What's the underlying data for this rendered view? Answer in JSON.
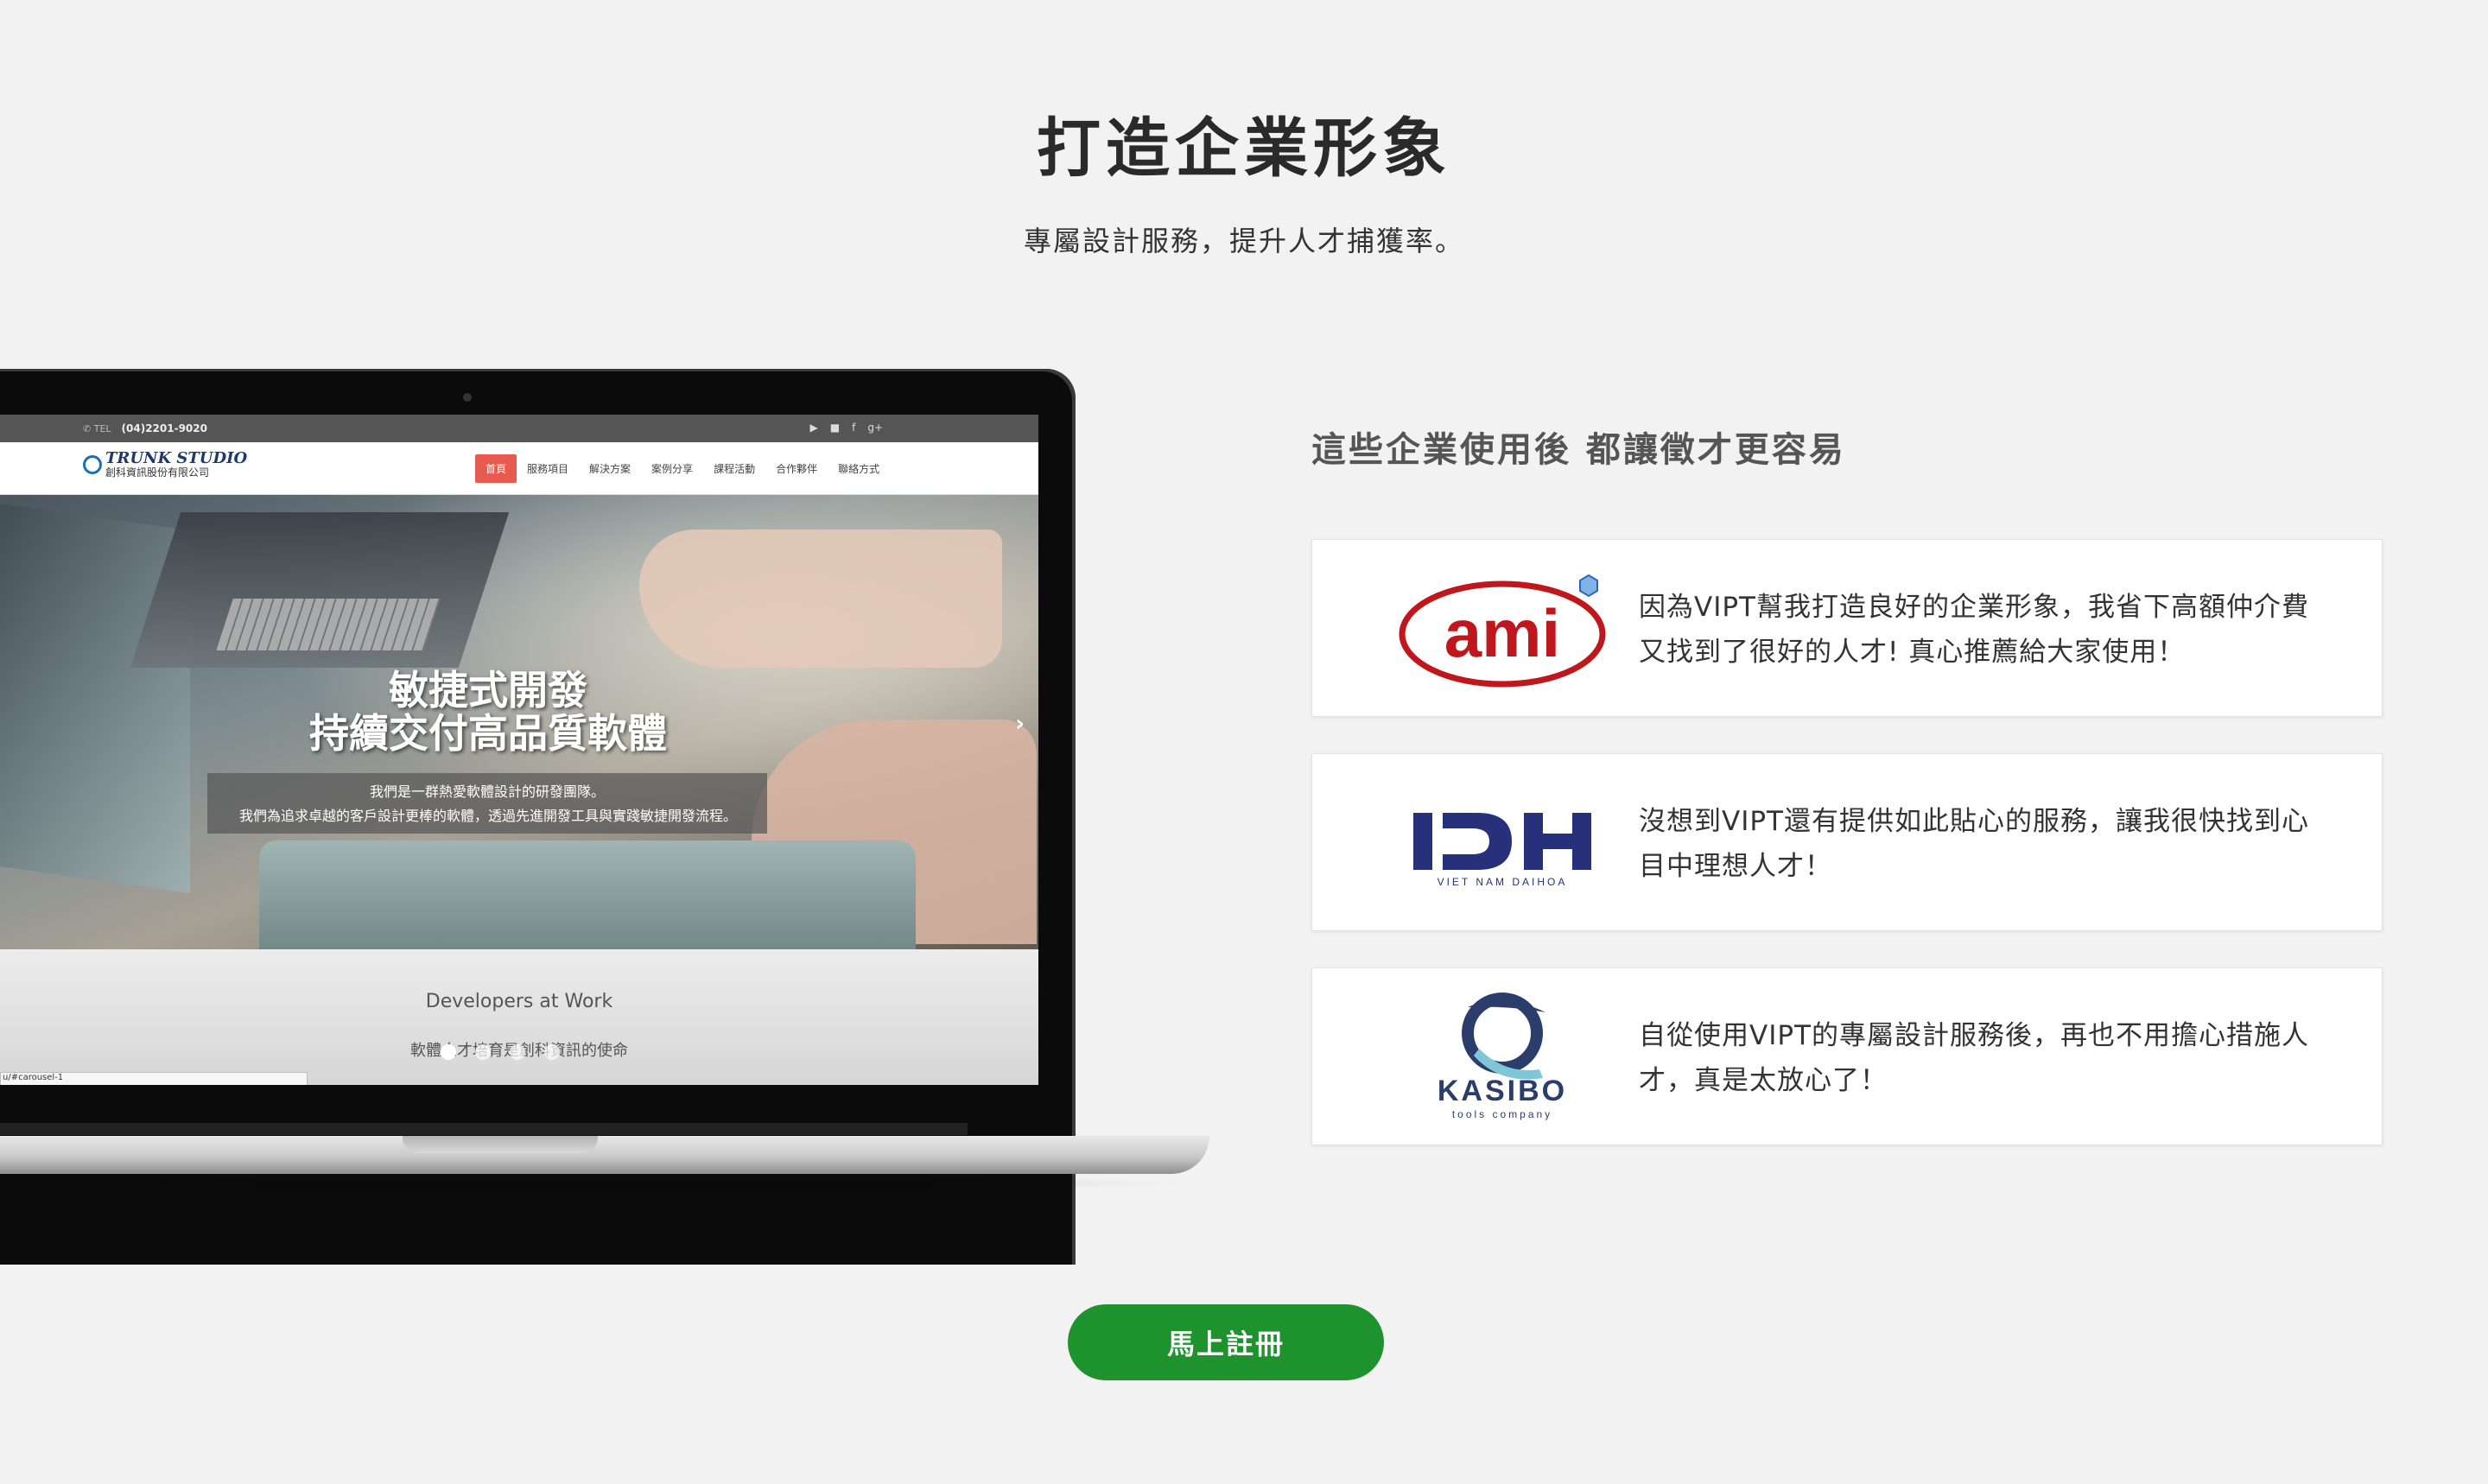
{
  "section": {
    "title": "打造企業形象",
    "subtitle": "專屬設計服務，提升人才捕獲率。"
  },
  "mockup_site": {
    "tel_label": "TEL",
    "tel": "(04)2201-9020",
    "logo_name": "TRUNK STUDIO",
    "logo_sub": "創科資訊股份有限公司",
    "menu": [
      "首頁",
      "服務項目",
      "解決方案",
      "案例分享",
      "課程活動",
      "合作夥伴",
      "聯絡方式"
    ],
    "hero_title_1": "敏捷式開發",
    "hero_title_2": "持續交付高品質軟體",
    "hero_caption_1": "我們是一群熱愛軟體設計的研發團隊。",
    "hero_caption_2": "我們為追求卓越的客戶設計更棒的軟體，透過先進開發工具與實踐敏捷開發流程。",
    "lower_heading": "Developers at Work",
    "lower_motto": "軟體人才培育是創科資訊的使命",
    "status_url": "u/#carousel-1"
  },
  "testimonials": {
    "heading": "這些企業使用後 都讓徵才更容易",
    "items": [
      {
        "logo_text": "ami",
        "text": "因為VIPT幫我打造良好的企業形象，我省下高額仲介費又找到了很好的人才! 真心推薦給大家使用！"
      },
      {
        "logo_text": "IDH",
        "logo_sub": "VIET NAM DAIHOA",
        "text": "沒想到VIPT還有提供如此貼心的服務，讓我很快找到心目中理想人才！"
      },
      {
        "logo_text": "KASIBO",
        "logo_sub": "tools company",
        "text": "自從使用VIPT的專屬設計服務後，再也不用擔心措施人才，真是太放心了！"
      }
    ]
  },
  "cta": {
    "label": "馬上註冊"
  },
  "colors": {
    "accent": "#1d922d",
    "ami_red": "#c0171d",
    "idh_navy": "#27307a",
    "kasibo_navy": "#2a3d6b",
    "kasibo_cyan": "#7fc6d6",
    "nav_active": "#e85a4f"
  }
}
